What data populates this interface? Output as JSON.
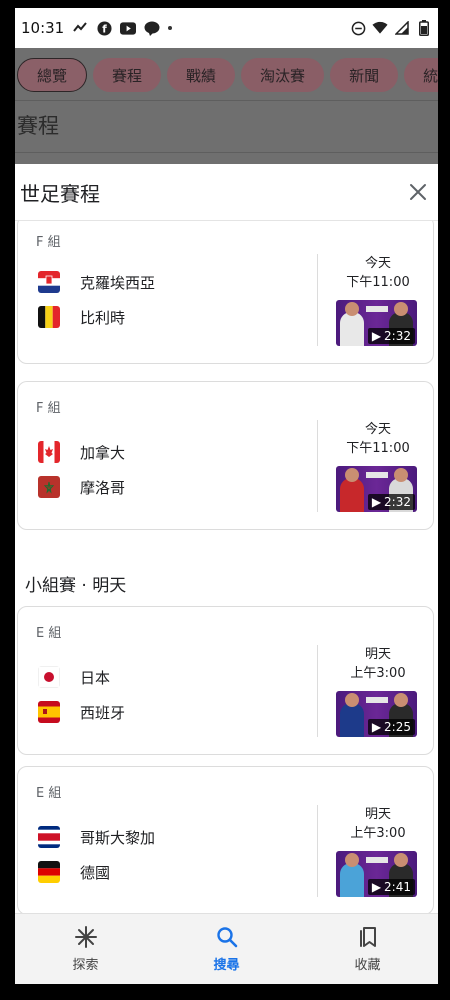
{
  "status_bar": {
    "time": "10:31",
    "icons": [
      "missed-call-icon",
      "facebook-icon",
      "youtube-icon",
      "line-icon",
      "dot-icon",
      "do-not-disturb-icon",
      "wifi-icon",
      "signal-icon",
      "battery-icon"
    ]
  },
  "background": {
    "chips": [
      "總覽",
      "賽程",
      "戰績",
      "淘汰賽",
      "新聞",
      "統"
    ],
    "title": "賽程"
  },
  "sheet": {
    "title": "世足賽程",
    "section_tomorrow": "小組賽 · 明天"
  },
  "matches": [
    {
      "group": "F 組",
      "team1": "克羅埃西亞",
      "team2": "比利時",
      "day": "今天",
      "time": "下午11:00",
      "duration": "2:32"
    },
    {
      "group": "F 組",
      "team1": "加拿大",
      "team2": "摩洛哥",
      "day": "今天",
      "time": "下午11:00",
      "duration": "2:32"
    },
    {
      "group": "E 組",
      "team1": "日本",
      "team2": "西班牙",
      "day": "明天",
      "time": "上午3:00",
      "duration": "2:25"
    },
    {
      "group": "E 組",
      "team1": "哥斯大黎加",
      "team2": "德國",
      "day": "明天",
      "time": "上午3:00",
      "duration": "2:41"
    }
  ],
  "bottom_nav": {
    "discover": "探索",
    "search": "搜尋",
    "saved": "收藏"
  },
  "colors": {
    "accent": "#1a73e8",
    "thumbnail_purple": "#5a1f8a"
  }
}
